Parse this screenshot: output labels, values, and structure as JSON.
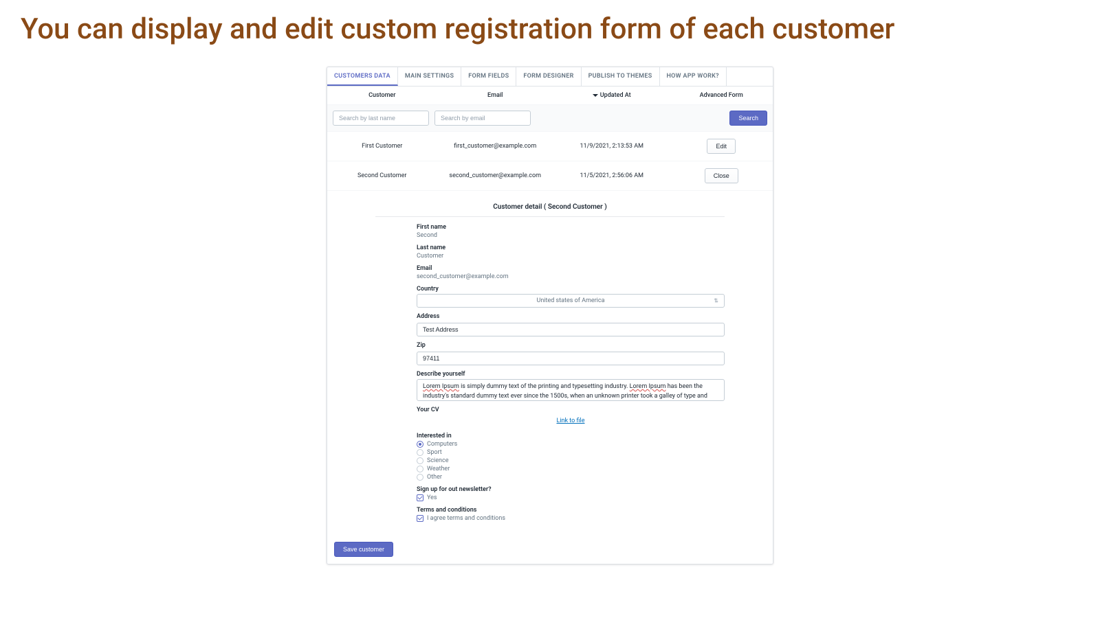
{
  "headline": "You can display and edit custom registration form of each customer",
  "tabs": [
    {
      "label": "CUSTOMERS DATA",
      "active": true
    },
    {
      "label": "MAIN SETTINGS",
      "active": false
    },
    {
      "label": "FORM FIELDS",
      "active": false
    },
    {
      "label": "FORM DESIGNER",
      "active": false
    },
    {
      "label": "PUBLISH TO THEMES",
      "active": false
    },
    {
      "label": "HOW APP WORK?",
      "active": false
    }
  ],
  "columns": {
    "customer": "Customer",
    "email": "Email",
    "updated": "Updated At",
    "action": "Advanced Form"
  },
  "search": {
    "lastname_placeholder": "Search by last name",
    "email_placeholder": "Search by email",
    "button": "Search"
  },
  "rows": [
    {
      "customer": "First Customer",
      "email": "first_customer@example.com",
      "updated": "11/9/2021, 2:13:53 AM",
      "action": "Edit"
    },
    {
      "customer": "Second Customer",
      "email": "second_customer@example.com",
      "updated": "11/5/2021, 2:56:06 AM",
      "action": "Close"
    }
  ],
  "detail": {
    "title": "Customer detail ( Second Customer )",
    "first_name_label": "First name",
    "first_name_value": "Second",
    "last_name_label": "Last name",
    "last_name_value": "Customer",
    "email_label": "Email",
    "email_value": "second_customer@example.com",
    "country_label": "Country",
    "country_value": "United states of America",
    "address_label": "Address",
    "address_value": "Test Address",
    "zip_label": "Zip",
    "zip_value": "97411",
    "describe_label": "Describe yourself",
    "describe_value_pre1": "Lorem Ipsum",
    "describe_value_mid1": " is simply dummy text of the printing and typesetting industry. ",
    "describe_value_pre2": "Lorem Ipsum",
    "describe_value_mid2": " has been the industry's standard dummy text ever since the 1500s, when an unknown printer took a galley of type and",
    "cv_label": "Your CV",
    "cv_link": "Link to file",
    "interested_label": "Interested in",
    "interests": [
      {
        "label": "Computers",
        "checked": true
      },
      {
        "label": "Sport",
        "checked": false
      },
      {
        "label": "Science",
        "checked": false
      },
      {
        "label": "Weather",
        "checked": false
      },
      {
        "label": "Other",
        "checked": false
      }
    ],
    "newsletter_label": "Sign up for out newsletter?",
    "newsletter_option": "Yes",
    "newsletter_checked": true,
    "terms_label": "Terms and conditions",
    "terms_option": "I agree terms and conditions",
    "terms_checked": true
  },
  "save_button": "Save customer"
}
